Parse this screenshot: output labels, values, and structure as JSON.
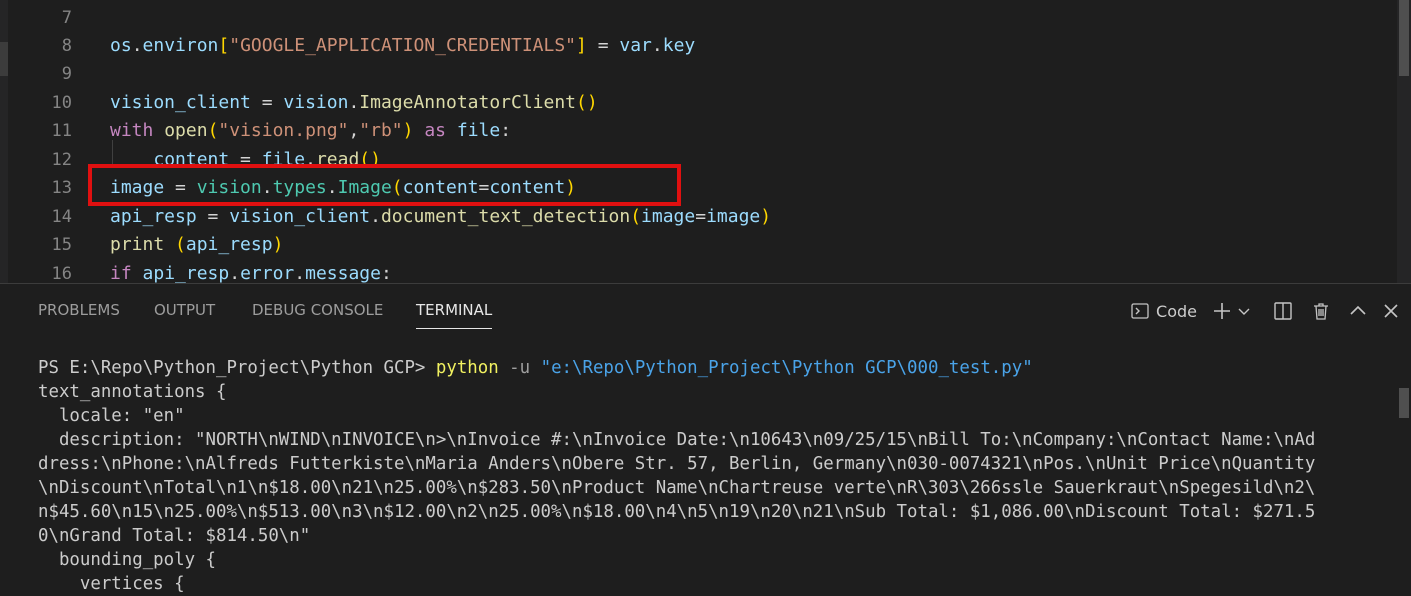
{
  "editor": {
    "line_numbers": [
      "7",
      "8",
      "9",
      "10",
      "11",
      "12",
      "13",
      "14",
      "15",
      "16"
    ],
    "line8": {
      "a": "os",
      "b": ".",
      "c": "environ",
      "d": "[",
      "e": "\"GOOGLE_APPLICATION_CREDENTIALS\"",
      "f": "]",
      "g": " = ",
      "h": "var",
      "i": ".",
      "j": "key"
    },
    "line10": {
      "a": "vision_client",
      "b": " = ",
      "c": "vision",
      "d": ".",
      "e": "ImageAnnotatorClient",
      "f": "()"
    },
    "line11": {
      "a": "with",
      "b": " ",
      "c": "open",
      "d": "(",
      "e": "\"vision.png\"",
      "f": ",",
      "g": "\"rb\"",
      "h": ")",
      "i": " ",
      "j": "as",
      "k": " ",
      "l": "file",
      ":": ":"
    },
    "line12": {
      "a": "    ",
      "b": "content",
      "c": " = ",
      "d": "file",
      "e": ".",
      "f": "read",
      "g": "()"
    },
    "line13": {
      "a": "image",
      "b": " = ",
      "c": "vision",
      "d": ".",
      "e": "types",
      "f": ".",
      "g": "Image",
      "h": "(",
      "i": "content",
      "j": "=",
      "k": "content",
      "l": ")"
    },
    "line14": {
      "a": "api_resp",
      "b": " = ",
      "c": "vision_client",
      "d": ".",
      "e": "document_text_detection",
      "f": "(",
      "g": "image",
      "h": "=",
      "i": "image",
      "j": ")"
    },
    "line15": {
      "a": "print",
      "b": " ",
      "c": "(",
      "d": "api_resp",
      "e": ")"
    },
    "line16": {
      "a": "if",
      "b": " ",
      "c": "api_resp",
      "d": ".",
      "e": "error",
      "f": ".",
      "g": "message",
      ":": ":"
    }
  },
  "panel": {
    "tabs": [
      "PROBLEMS",
      "OUTPUT",
      "DEBUG CONSOLE",
      "TERMINAL"
    ],
    "terminal_label": "Code"
  },
  "terminal": {
    "prompt": "PS E:\\Repo\\Python_Project\\Python GCP> ",
    "cmd": "python",
    "flag": " -u ",
    "path": "\"e:\\Repo\\Python_Project\\Python GCP\\000_test.py\"",
    "lines": [
      "text_annotations {",
      "  locale: \"en\"",
      "  description: \"NORTH\\nWIND\\nINVOICE\\n>\\nInvoice #:\\nInvoice Date:\\n10643\\n09/25/15\\nBill To:\\nCompany:\\nContact Name:\\nAd",
      "dress:\\nPhone:\\nAlfreds Futterkiste\\nMaria Anders\\nObere Str. 57, Berlin, Germany\\n030-0074321\\nPos.\\nUnit Price\\nQuantity",
      "\\nDiscount\\nTotal\\n1\\n$18.00\\n21\\n25.00%\\n$283.50\\nProduct Name\\nChartreuse verte\\nR\\303\\266ssle Sauerkraut\\nSpegesild\\n2\\",
      "n$45.60\\n15\\n25.00%\\n$513.00\\n3\\n$12.00\\n2\\n25.00%\\n$18.00\\n4\\n5\\n19\\n20\\n21\\nSub Total: $1,086.00\\nDiscount Total: $271.5",
      "0\\nGrand Total: $814.50\\n\"",
      "  bounding_poly {",
      "    vertices {"
    ]
  }
}
